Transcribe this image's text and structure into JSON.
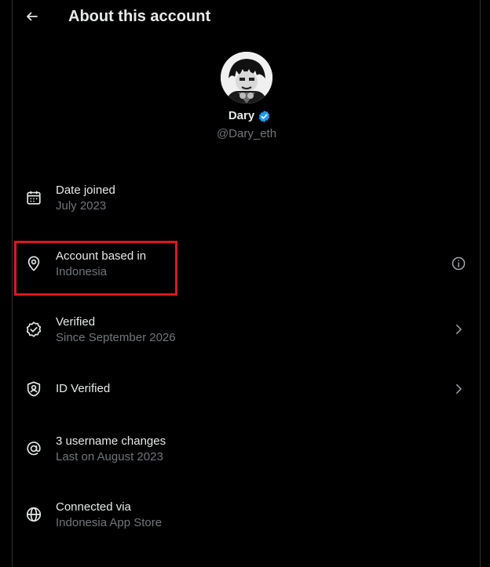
{
  "header": {
    "title": "About this account",
    "back_icon": "arrow-left-icon"
  },
  "profile": {
    "name": "Dary",
    "handle": "@Dary_eth",
    "verified_badge_color": "#1d9bf0"
  },
  "colors": {
    "background": "#000000",
    "text_primary": "#e7e9ea",
    "text_secondary": "#71767b",
    "highlight": "#d9191f"
  },
  "rows": [
    {
      "icon": "calendar-icon",
      "label": "Date joined",
      "value": "July 2023"
    },
    {
      "icon": "location-pin-icon",
      "label": "Account based in",
      "value": "Indonesia",
      "trailing_icon": "info-icon"
    },
    {
      "icon": "verified-check-icon",
      "label": "Verified",
      "value": "Since September 2026",
      "trailing_icon": "chevron-right-icon"
    },
    {
      "icon": "id-shield-icon",
      "label": "ID Verified",
      "value": "",
      "trailing_icon": "chevron-right-icon"
    },
    {
      "icon": "at-sign-icon",
      "label": "3 username changes",
      "value": "Last on August 2023"
    },
    {
      "icon": "globe-icon",
      "label": "Connected via",
      "value": "Indonesia App Store"
    }
  ]
}
